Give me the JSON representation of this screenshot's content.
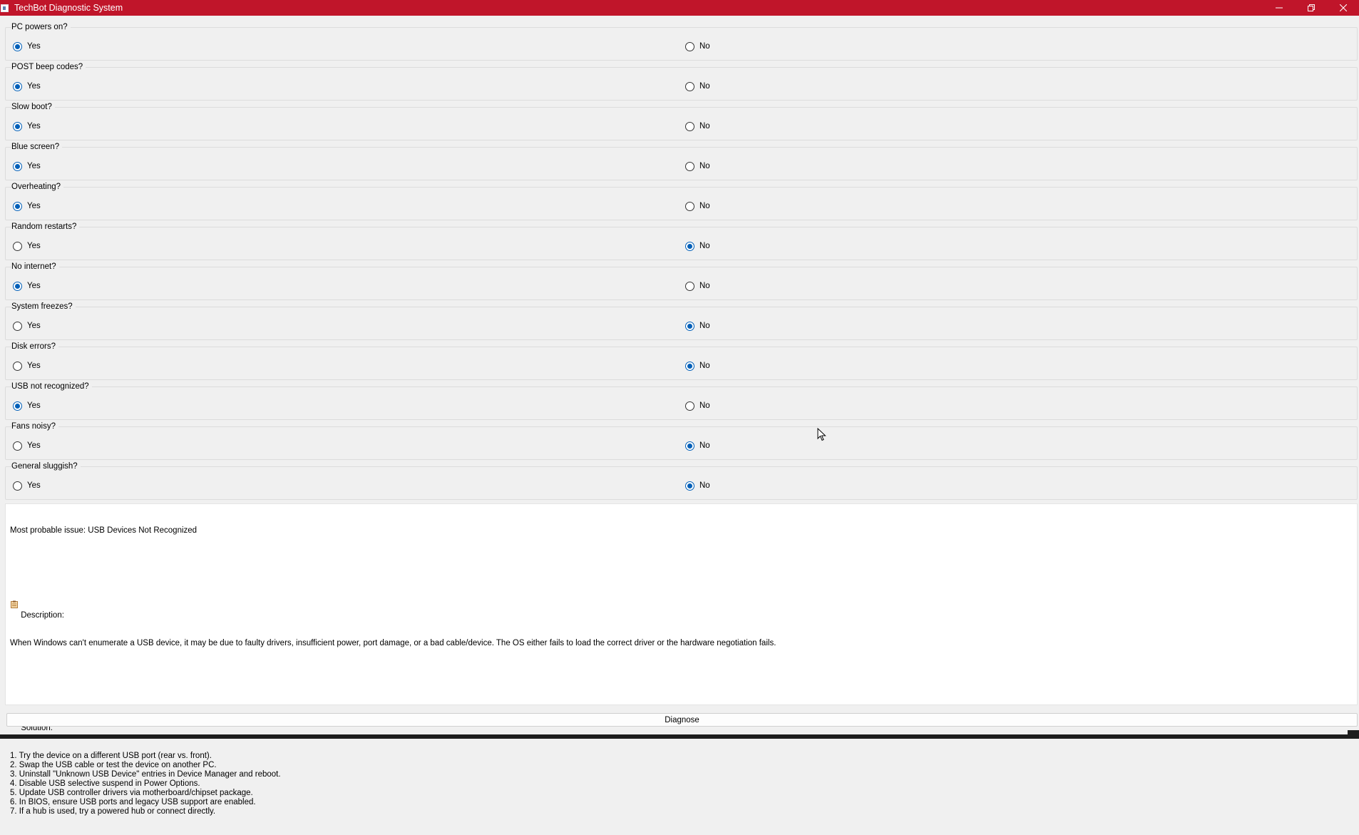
{
  "window": {
    "title": "TechBot Diagnostic System",
    "title_bar_color": "#c0152a",
    "icons": {
      "minimize": "minimize-icon",
      "maximize": "restore-icon",
      "close": "close-icon"
    }
  },
  "questions": [
    {
      "label": "PC powers on?",
      "yes": "Yes",
      "no": "No",
      "selected": "yes"
    },
    {
      "label": "POST beep codes?",
      "yes": "Yes",
      "no": "No",
      "selected": "yes"
    },
    {
      "label": "Slow boot?",
      "yes": "Yes",
      "no": "No",
      "selected": "yes"
    },
    {
      "label": "Blue screen?",
      "yes": "Yes",
      "no": "No",
      "selected": "yes"
    },
    {
      "label": "Overheating?",
      "yes": "Yes",
      "no": "No",
      "selected": "yes"
    },
    {
      "label": "Random restarts?",
      "yes": "Yes",
      "no": "No",
      "selected": "no"
    },
    {
      "label": "No internet?",
      "yes": "Yes",
      "no": "No",
      "selected": "yes"
    },
    {
      "label": "System freezes?",
      "yes": "Yes",
      "no": "No",
      "selected": "no"
    },
    {
      "label": "Disk errors?",
      "yes": "Yes",
      "no": "No",
      "selected": "no"
    },
    {
      "label": "USB not recognized?",
      "yes": "Yes",
      "no": "No",
      "selected": "yes"
    },
    {
      "label": "Fans noisy?",
      "yes": "Yes",
      "no": "No",
      "selected": "no"
    },
    {
      "label": "General sluggish?",
      "yes": "Yes",
      "no": "No",
      "selected": "no"
    }
  ],
  "result": {
    "issue_line": "Most probable issue: USB Devices Not Recognized",
    "description_header": "Description:",
    "description_icon": "clipboard-icon",
    "description_text": "When Windows can't enumerate a USB device, it may be due to faulty drivers, insufficient power, port damage, or a bad cable/device. The OS either fails to load the correct driver or the hardware negotiation fails.",
    "solution_header": "Solution:",
    "solution_icon": "tools-icon",
    "steps": [
      "1. Try the device on a different USB port (rear vs. front).",
      "2. Swap the USB cable or test the device on another PC.",
      "3. Uninstall \"Unknown USB Device\" entries in Device Manager and reboot.",
      "4. Disable USB selective suspend in Power Options.",
      "5. Update USB controller drivers via motherboard/chipset package.",
      "6. In BIOS, ensure USB ports and legacy USB support are enabled.",
      "7. If a hub is used, try a powered hub or connect directly."
    ]
  },
  "diagnose_label": "Diagnose",
  "colors": {
    "radio_accent": "#005fb8",
    "result_bg": "#ffffff"
  }
}
